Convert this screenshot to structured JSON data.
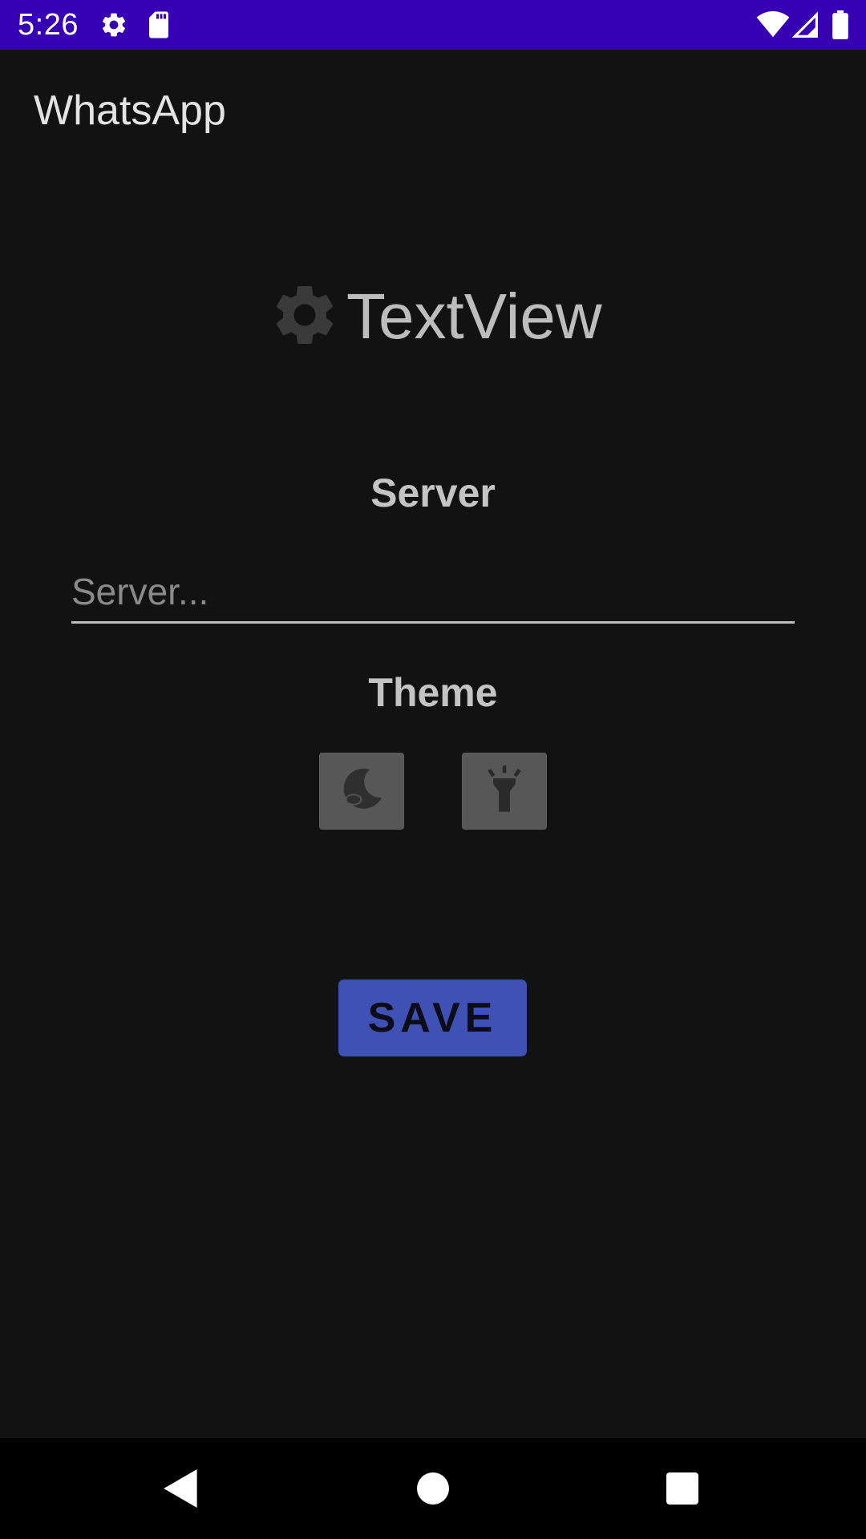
{
  "status_bar": {
    "time": "5:26",
    "background_color": "#3700b3",
    "icons": [
      "gear-icon",
      "sd-card-icon",
      "wifi-icon",
      "signal-icon",
      "battery-icon"
    ]
  },
  "app": {
    "title": "WhatsApp"
  },
  "hero": {
    "icon": "gear-icon",
    "text": "TextView"
  },
  "server": {
    "label": "Server",
    "placeholder": "Server...",
    "value": ""
  },
  "theme": {
    "label": "Theme",
    "options": [
      {
        "icon": "night-moon-icon",
        "name": "dark"
      },
      {
        "icon": "flashlight-icon",
        "name": "light"
      }
    ]
  },
  "save_button": {
    "label": "SAVE",
    "color": "#3f51b5"
  },
  "nav_bar": {
    "icons": [
      "back-icon",
      "home-icon",
      "recents-icon"
    ]
  }
}
